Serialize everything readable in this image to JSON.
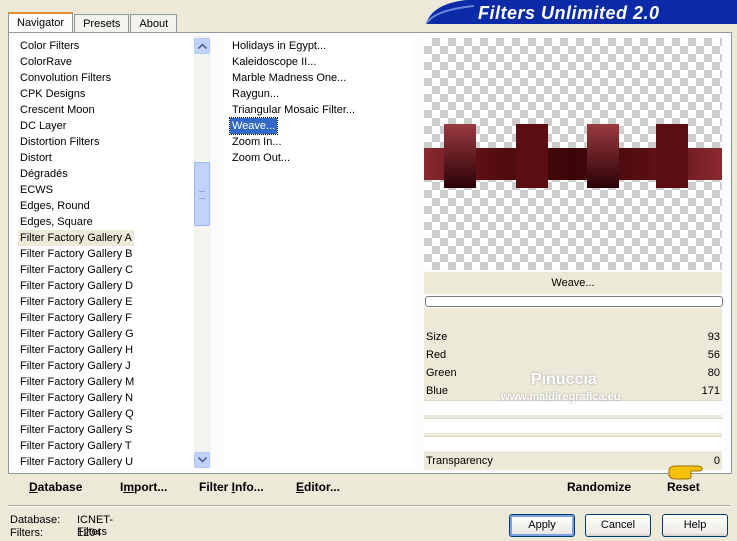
{
  "tabs": [
    {
      "label": "Navigator",
      "active": true
    },
    {
      "label": "Presets",
      "active": false
    },
    {
      "label": "About",
      "active": false
    }
  ],
  "app_title": "Filters Unlimited 2.0",
  "categories": [
    "Color Filters",
    "ColorRave",
    "Convolution Filters",
    "CPK Designs",
    "Crescent Moon",
    "DC Layer",
    "Distortion Filters",
    "Distort",
    "Dégradés",
    "ECWS",
    "Edges, Round",
    "Edges, Square",
    "Filter Factory Gallery A",
    "Filter Factory Gallery B",
    "Filter Factory Gallery C",
    "Filter Factory Gallery D",
    "Filter Factory Gallery E",
    "Filter Factory Gallery F",
    "Filter Factory Gallery G",
    "Filter Factory Gallery H",
    "Filter Factory Gallery J",
    "Filter Factory Gallery M",
    "Filter Factory Gallery N",
    "Filter Factory Gallery Q",
    "Filter Factory Gallery S",
    "Filter Factory Gallery T",
    "Filter Factory Gallery U"
  ],
  "selected_category": "Filter Factory Gallery A",
  "filters": [
    "Holidays in Egypt...",
    "Kaleidoscope II...",
    "Marble Madness One...",
    "Raygun...",
    "Triangular Mosaic Filter...",
    "Weave...",
    "Zoom In...",
    "Zoom Out..."
  ],
  "selected_filter": "Weave...",
  "preview": {
    "title": "Weave...",
    "weave_color": "#5a0e14",
    "band_color": "#8a2a30",
    "progress_percent": 0
  },
  "params": [
    {
      "name": "Size",
      "value": "93"
    },
    {
      "name": "Red",
      "value": "56"
    },
    {
      "name": "Green",
      "value": "80"
    },
    {
      "name": "Blue",
      "value": "171"
    }
  ],
  "transparency": {
    "name": "Transparency",
    "value": "0"
  },
  "watermark": {
    "name": "Pinuccia",
    "url": "www.maidiregrafica.eu"
  },
  "param_buttons": {
    "randomize": "Randomize",
    "reset": "Reset"
  },
  "bottom_buttons": {
    "database": {
      "u": "D",
      "rest": "atabase"
    },
    "import": {
      "pre": "I",
      "u": "m",
      "rest": "port..."
    },
    "filter_info": {
      "pre": "Filter ",
      "u": "I",
      "rest": "nfo..."
    },
    "editor": {
      "u": "E",
      "rest": "ditor..."
    }
  },
  "status": {
    "database_label": "Database:",
    "database_value": "ICNET-Filters",
    "filters_label": "Filters:",
    "filters_value": "1204"
  },
  "dialog_buttons": {
    "apply": "Apply",
    "cancel": "Cancel",
    "help": "Help"
  },
  "colors": {
    "banner": "#0a2aa8",
    "selection": "#316ac5",
    "accent_tab": "#e68b2c"
  }
}
